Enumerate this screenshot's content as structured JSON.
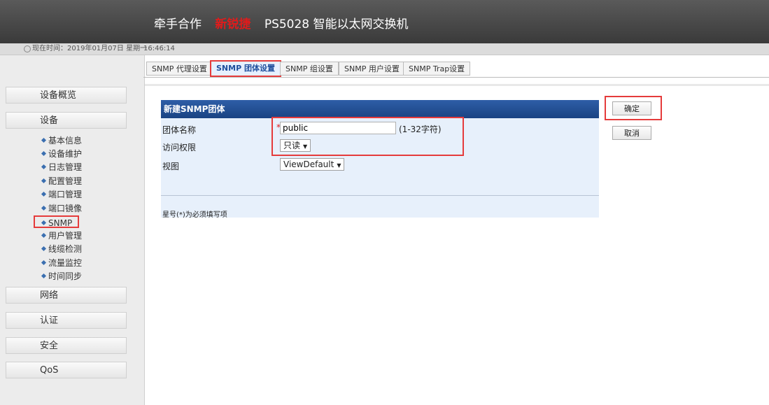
{
  "header": {
    "product_prefix": "牵手合作",
    "brand": "新锐捷",
    "product_name": "PS5028 智能以太网交换机"
  },
  "time_bar": {
    "label": "现在时间：2019年01月07日  星期一",
    "time": "16:46:14"
  },
  "tabs": [
    {
      "label": "SNMP 代理设置"
    },
    {
      "label": "SNMP 团体设置"
    },
    {
      "label": "SNMP 组设置"
    },
    {
      "label": "SNMP 用户设置"
    },
    {
      "label": "SNMP Trap设置"
    }
  ],
  "sidebar": {
    "overview": "设备概览",
    "device": "设备",
    "device_items": [
      "基本信息",
      "设备维护",
      "日志管理",
      "配置管理",
      "端口管理",
      "端口镜像",
      "SNMP",
      "用户管理",
      "线缆检测",
      "流量监控",
      "时间同步"
    ],
    "network": "网络",
    "auth": "认证",
    "security": "安全",
    "qos": "QoS"
  },
  "form": {
    "header": "新建SNMP团体",
    "name_label": "团体名称",
    "required_mark": "*",
    "name_value": "public",
    "name_hint": "(1-32字符)",
    "access_label": "访问权限",
    "access_value": "只读",
    "view_label": "视图",
    "view_value": "ViewDefault",
    "note": "星号(*)为必须填写项"
  },
  "actions": {
    "ok": "确定",
    "cancel": "取消"
  }
}
